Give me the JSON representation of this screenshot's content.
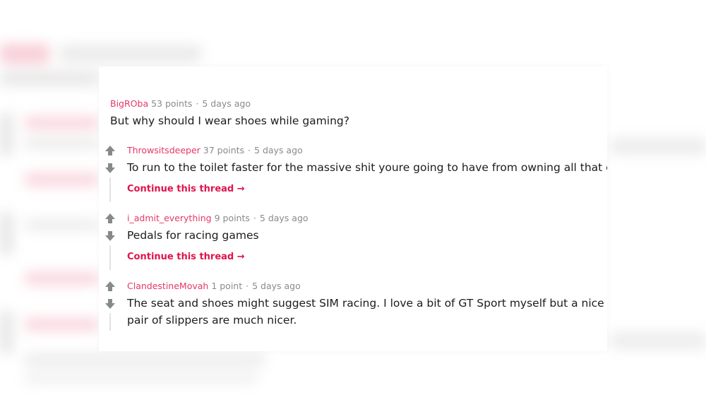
{
  "colors": {
    "username": "#e63766",
    "continue_link": "#e0144c",
    "meta": "#878a8c",
    "text": "#1c1c1c",
    "vote_arrow": "#878a8c"
  },
  "comments": [
    {
      "user": "BigROba",
      "points": "53 points",
      "separator": "·",
      "time": "5 days ago",
      "text": "But why should I wear shoes while gaming?"
    },
    {
      "user": "Throwsitsdeeper",
      "points": "37 points",
      "separator": "·",
      "time": "5 days ago",
      "text": "To run to the toilet faster for the massive shit youre going to have from owning all that coo",
      "continue": "Continue this thread →"
    },
    {
      "user": "i_admit_everything",
      "points": "9 points",
      "separator": "·",
      "time": "5 days ago",
      "text": "Pedals for racing games",
      "continue": "Continue this thread →"
    },
    {
      "user": "ClandestineMovah",
      "points": "1 point",
      "separator": "·",
      "time": "5 days ago",
      "text_line1": "The seat and shoes might suggest SIM racing. I love a bit of GT Sport myself but a nice cor",
      "text_line2": "pair of slippers are much nicer."
    }
  ],
  "icons": {
    "upvote": "arrow-up-icon",
    "downvote": "arrow-down-icon"
  }
}
